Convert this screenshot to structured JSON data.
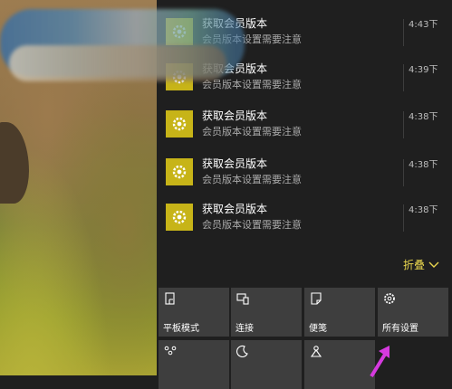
{
  "notifications": [
    {
      "title": "获取会员版本",
      "body": "会员版本设置需要注意",
      "time": "4:43下"
    },
    {
      "title": "获取会员版本",
      "body": "会员版本设置需要注意",
      "time": "4:39下"
    },
    {
      "title": "获取会员版本",
      "body": "会员版本设置需要注意",
      "time": "4:38下"
    },
    {
      "title": "获取会员版本",
      "body": "会员版本设置需要注意",
      "time": "4:38下"
    },
    {
      "title": "获取会员版本",
      "body": "会员版本设置需要注意",
      "time": "4:38下"
    }
  ],
  "collapse_label": "折叠",
  "quick_actions": [
    {
      "label": "平板模式",
      "icon": "tablet-mode-icon"
    },
    {
      "label": "连接",
      "icon": "connect-icon"
    },
    {
      "label": "便笺",
      "icon": "note-icon"
    },
    {
      "label": "所有设置",
      "icon": "settings-icon"
    },
    {
      "label": "",
      "icon": "network-icon"
    },
    {
      "label": "",
      "icon": "moon-icon"
    },
    {
      "label": "",
      "icon": "location-icon"
    }
  ],
  "colors": {
    "panel_bg": "#1f1f1f",
    "tile_bg": "#3e3e3e",
    "app_icon": "#c7b418",
    "accent_text": "#e8d54e",
    "annotation_arrow": "#d63adf"
  }
}
